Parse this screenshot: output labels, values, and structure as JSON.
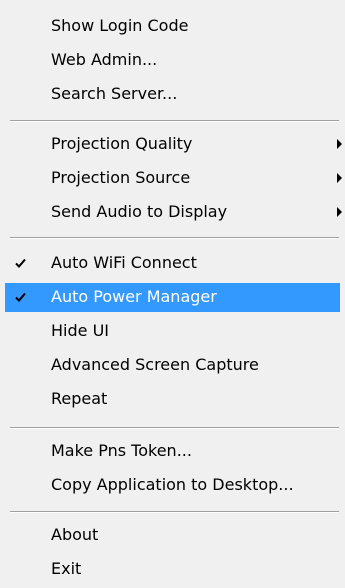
{
  "menu": {
    "items": [
      {
        "label": "Show Login Code"
      },
      {
        "label": "Web Admin..."
      },
      {
        "label": "Search Server..."
      },
      {
        "label": "Projection Quality",
        "submenu": true
      },
      {
        "label": "Projection Source",
        "submenu": true
      },
      {
        "label": "Send Audio to Display",
        "submenu": true
      },
      {
        "label": "Auto WiFi Connect",
        "checked": true
      },
      {
        "label": "Auto Power Manager",
        "checked": true,
        "highlighted": true
      },
      {
        "label": "Hide UI"
      },
      {
        "label": "Advanced Screen Capture"
      },
      {
        "label": "Repeat"
      },
      {
        "label": "Make Pns Token..."
      },
      {
        "label": "Copy Application to Desktop..."
      },
      {
        "label": "About"
      },
      {
        "label": "Exit"
      }
    ]
  },
  "colors": {
    "highlight": "#3399ff",
    "background": "#f0f0f0"
  }
}
